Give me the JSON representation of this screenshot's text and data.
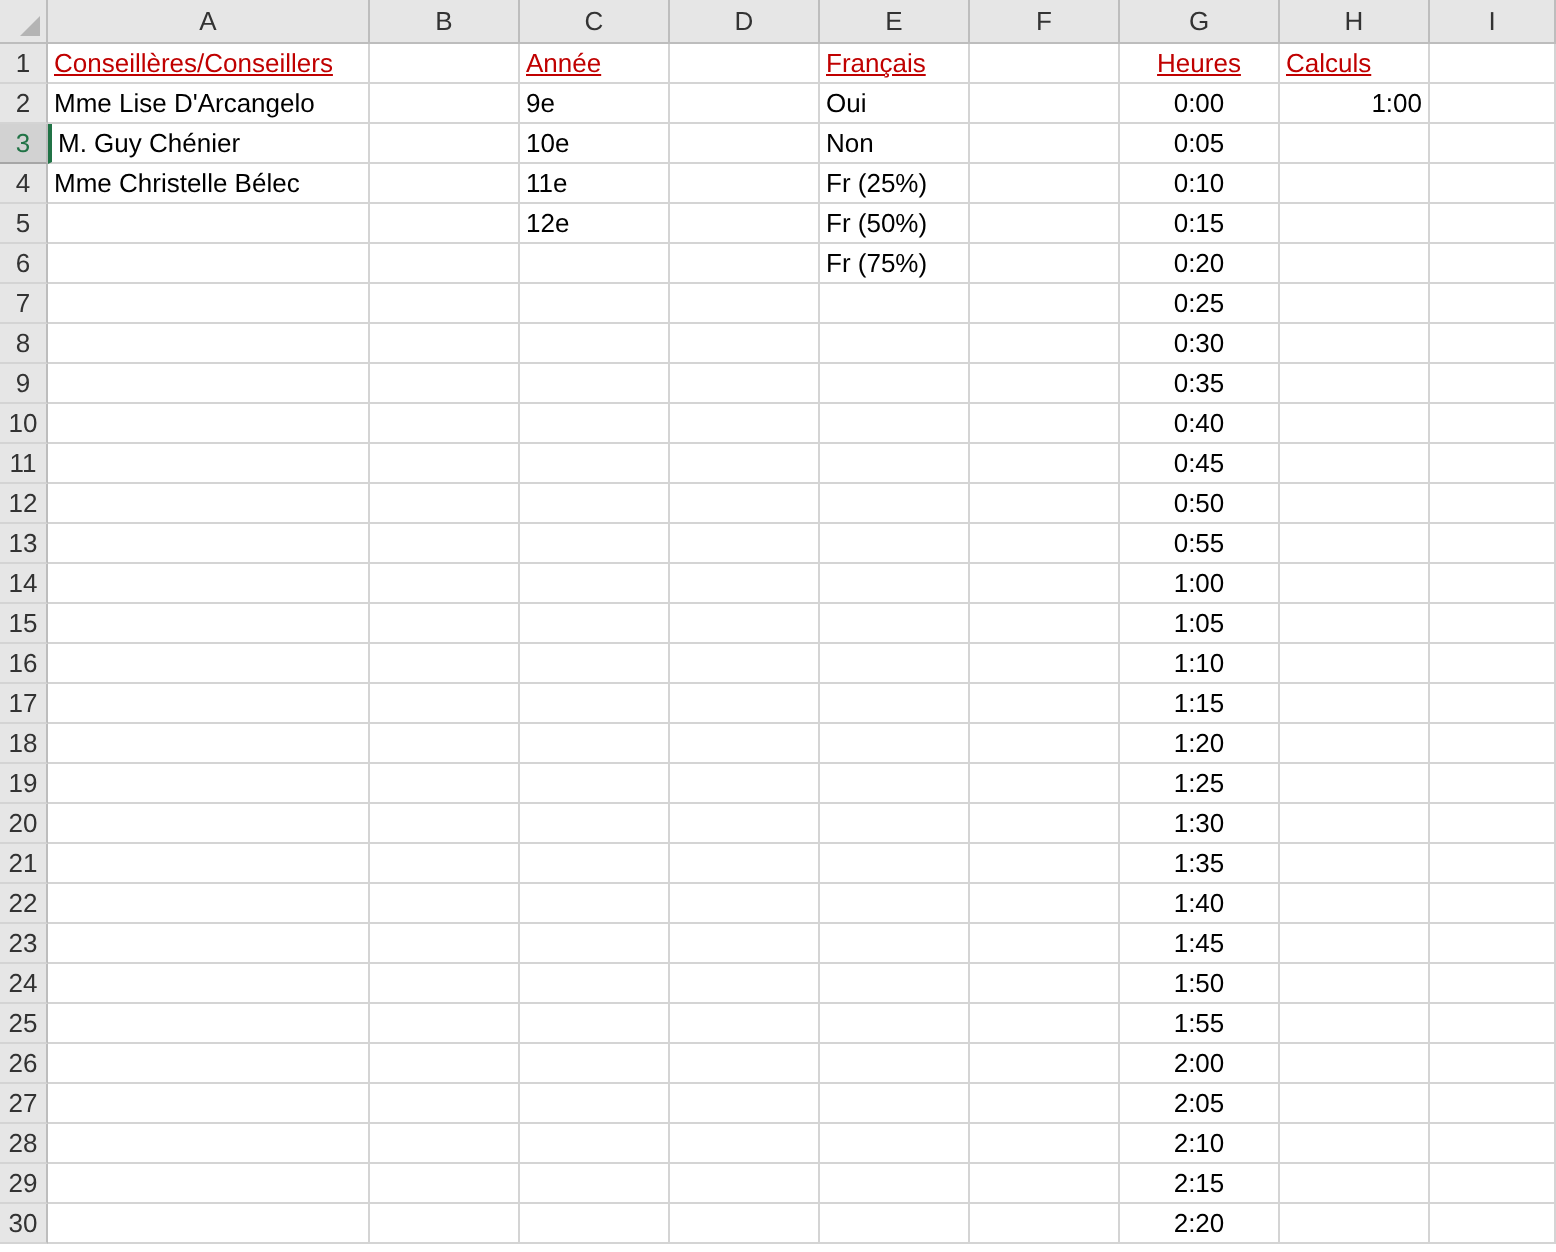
{
  "columns": [
    "A",
    "B",
    "C",
    "D",
    "E",
    "F",
    "G",
    "H",
    "I"
  ],
  "rows": [
    {
      "number": "1",
      "selected": false,
      "kind": "header",
      "cells": [
        "Conseillères/Conseillers",
        null,
        "Année",
        null,
        "Français",
        null,
        "Heures",
        "Calculs",
        null
      ]
    },
    {
      "number": "2",
      "selected": false,
      "kind": "data",
      "cells": [
        "Mme Lise D'Arcangelo",
        null,
        "9e",
        null,
        "Oui",
        null,
        "0:00",
        "1:00",
        null
      ]
    },
    {
      "number": "3",
      "selected": true,
      "kind": "data",
      "cells": [
        "M. Guy Chénier",
        null,
        "10e",
        null,
        "Non",
        null,
        "0:05",
        null,
        null
      ]
    },
    {
      "number": "4",
      "selected": false,
      "kind": "data",
      "cells": [
        "Mme Christelle Bélec",
        null,
        "11e",
        null,
        "Fr (25%)",
        null,
        "0:10",
        null,
        null
      ]
    },
    {
      "number": "5",
      "selected": false,
      "kind": "data",
      "cells": [
        null,
        null,
        "12e",
        null,
        "Fr (50%)",
        null,
        "0:15",
        null,
        null
      ]
    },
    {
      "number": "6",
      "selected": false,
      "kind": "data",
      "cells": [
        null,
        null,
        null,
        null,
        "Fr (75%)",
        null,
        "0:20",
        null,
        null
      ]
    },
    {
      "number": "7",
      "selected": false,
      "kind": "data",
      "cells": [
        null,
        null,
        null,
        null,
        null,
        null,
        "0:25",
        null,
        null
      ]
    },
    {
      "number": "8",
      "selected": false,
      "kind": "data",
      "cells": [
        null,
        null,
        null,
        null,
        null,
        null,
        "0:30",
        null,
        null
      ]
    },
    {
      "number": "9",
      "selected": false,
      "kind": "data",
      "cells": [
        null,
        null,
        null,
        null,
        null,
        null,
        "0:35",
        null,
        null
      ]
    },
    {
      "number": "10",
      "selected": false,
      "kind": "data",
      "cells": [
        null,
        null,
        null,
        null,
        null,
        null,
        "0:40",
        null,
        null
      ]
    },
    {
      "number": "11",
      "selected": false,
      "kind": "data",
      "cells": [
        null,
        null,
        null,
        null,
        null,
        null,
        "0:45",
        null,
        null
      ]
    },
    {
      "number": "12",
      "selected": false,
      "kind": "data",
      "cells": [
        null,
        null,
        null,
        null,
        null,
        null,
        "0:50",
        null,
        null
      ]
    },
    {
      "number": "13",
      "selected": false,
      "kind": "data",
      "cells": [
        null,
        null,
        null,
        null,
        null,
        null,
        "0:55",
        null,
        null
      ]
    },
    {
      "number": "14",
      "selected": false,
      "kind": "data",
      "cells": [
        null,
        null,
        null,
        null,
        null,
        null,
        "1:00",
        null,
        null
      ]
    },
    {
      "number": "15",
      "selected": false,
      "kind": "data",
      "cells": [
        null,
        null,
        null,
        null,
        null,
        null,
        "1:05",
        null,
        null
      ]
    },
    {
      "number": "16",
      "selected": false,
      "kind": "data",
      "cells": [
        null,
        null,
        null,
        null,
        null,
        null,
        "1:10",
        null,
        null
      ]
    },
    {
      "number": "17",
      "selected": false,
      "kind": "data",
      "cells": [
        null,
        null,
        null,
        null,
        null,
        null,
        "1:15",
        null,
        null
      ]
    },
    {
      "number": "18",
      "selected": false,
      "kind": "data",
      "cells": [
        null,
        null,
        null,
        null,
        null,
        null,
        "1:20",
        null,
        null
      ]
    },
    {
      "number": "19",
      "selected": false,
      "kind": "data",
      "cells": [
        null,
        null,
        null,
        null,
        null,
        null,
        "1:25",
        null,
        null
      ]
    },
    {
      "number": "20",
      "selected": false,
      "kind": "data",
      "cells": [
        null,
        null,
        null,
        null,
        null,
        null,
        "1:30",
        null,
        null
      ]
    },
    {
      "number": "21",
      "selected": false,
      "kind": "data",
      "cells": [
        null,
        null,
        null,
        null,
        null,
        null,
        "1:35",
        null,
        null
      ]
    },
    {
      "number": "22",
      "selected": false,
      "kind": "data",
      "cells": [
        null,
        null,
        null,
        null,
        null,
        null,
        "1:40",
        null,
        null
      ]
    },
    {
      "number": "23",
      "selected": false,
      "kind": "data",
      "cells": [
        null,
        null,
        null,
        null,
        null,
        null,
        "1:45",
        null,
        null
      ]
    },
    {
      "number": "24",
      "selected": false,
      "kind": "data",
      "cells": [
        null,
        null,
        null,
        null,
        null,
        null,
        "1:50",
        null,
        null
      ]
    },
    {
      "number": "25",
      "selected": false,
      "kind": "data",
      "cells": [
        null,
        null,
        null,
        null,
        null,
        null,
        "1:55",
        null,
        null
      ]
    },
    {
      "number": "26",
      "selected": false,
      "kind": "data",
      "cells": [
        null,
        null,
        null,
        null,
        null,
        null,
        "2:00",
        null,
        null
      ]
    },
    {
      "number": "27",
      "selected": false,
      "kind": "data",
      "cells": [
        null,
        null,
        null,
        null,
        null,
        null,
        "2:05",
        null,
        null
      ]
    },
    {
      "number": "28",
      "selected": false,
      "kind": "data",
      "cells": [
        null,
        null,
        null,
        null,
        null,
        null,
        "2:10",
        null,
        null
      ]
    },
    {
      "number": "29",
      "selected": false,
      "kind": "data",
      "cells": [
        null,
        null,
        null,
        null,
        null,
        null,
        "2:15",
        null,
        null
      ]
    },
    {
      "number": "30",
      "selected": false,
      "kind": "data",
      "cells": [
        null,
        null,
        null,
        null,
        null,
        null,
        "2:20",
        null,
        null
      ]
    }
  ]
}
